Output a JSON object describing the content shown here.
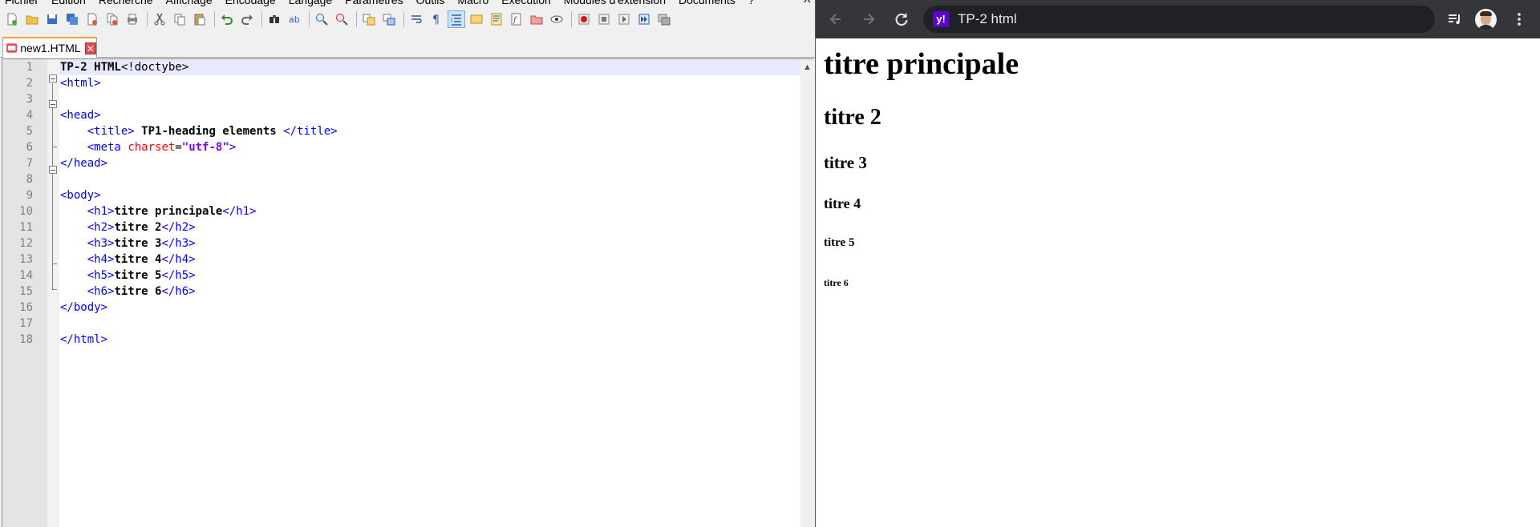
{
  "npp": {
    "menu": [
      "Fichier",
      "Édition",
      "Recherche",
      "Affichage",
      "Encodage",
      "Langage",
      "Paramètres",
      "Outils",
      "Macro",
      "Exécution",
      "Modules d'extension",
      "Documents",
      "?"
    ],
    "close_glyph": "X",
    "tab": {
      "label": "new1.HTML",
      "close_glyph": "✕"
    },
    "line_numbers": [
      "1",
      "2",
      "3",
      "4",
      "5",
      "6",
      "7",
      "8",
      "9",
      "10",
      "11",
      "12",
      "13",
      "14",
      "15",
      "16",
      "17",
      "18"
    ],
    "code": {
      "l1_bold": "TP-2 HTML",
      "l1_rest": "<!doctybe>",
      "l2": "<html>",
      "l4": "<head>",
      "l5_open": "<title>",
      "l5_text": " TP1-heading elements ",
      "l5_close": "</title>",
      "l6_tag": "<meta",
      "l6_attr": "charset",
      "l6_eq": "=",
      "l6_val": "\"utf-8\"",
      "l6_end": ">",
      "l7": "</head>",
      "l9": "<body>",
      "l10_open": "<h1>",
      "l10_text": "titre principale",
      "l10_close": "</h1>",
      "l11_open": "<h2>",
      "l11_text": "titre 2",
      "l11_close": "</h2>",
      "l12_open": "<h3>",
      "l12_text": "titre 3",
      "l12_close": "</h3>",
      "l13_open": "<h4>",
      "l13_text": "titre 4",
      "l13_close": "</h4>",
      "l14_open": "<h5>",
      "l14_text": "titre 5",
      "l14_close": "</h5>",
      "l15_open": "<h6>",
      "l15_text": "titre 6",
      "l15_close": "</h6>",
      "l16": "</body>",
      "l18": "</html>"
    }
  },
  "chrome": {
    "omnibox_text": "TP-2 html",
    "site_icon_letter": "y!",
    "page": {
      "h1": "titre principale",
      "h2": "titre 2",
      "h3": "titre 3",
      "h4": "titre 4",
      "h5": "titre 5",
      "h6": "titre 6"
    }
  }
}
